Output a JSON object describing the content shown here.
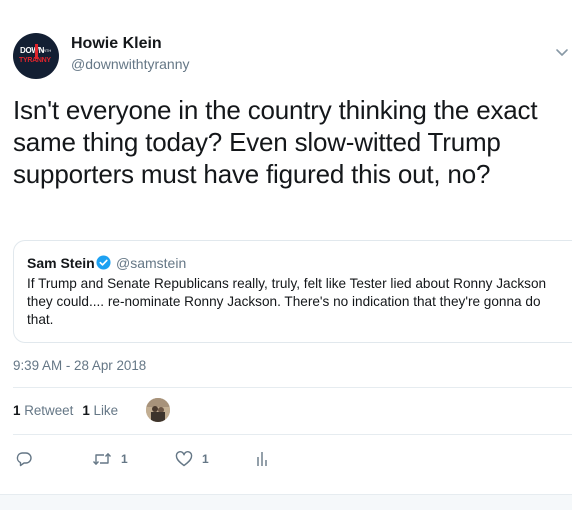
{
  "author": {
    "display_name": "Howie Klein",
    "handle": "@downwithtyranny",
    "avatar_text_top": "DOWN",
    "avatar_text_small": "WITH",
    "avatar_text_bottom": "TYRANNY"
  },
  "tweet": {
    "text": "Isn't everyone in the country thinking the exact same thing today? Even slow-witted Trump supporters must have figured this out, no?",
    "timestamp": "9:39 AM - 28 Apr 2018"
  },
  "quoted_tweet": {
    "display_name": "Sam Stein",
    "handle": "@samstein",
    "text": "If Trump and Senate Republicans really, truly, felt like Tester lied about Ronny Jackson they could.... re-nominate Ronny Jackson. There's no indication that they're gonna do that."
  },
  "stats": {
    "retweets_count": "1",
    "retweets_label": "Retweet",
    "likes_count": "1",
    "likes_label": "Like"
  },
  "actions": {
    "reply_icon": "reply-icon",
    "retweet_icon": "retweet-icon",
    "retweet_count": "1",
    "like_icon": "heart-icon",
    "like_count": "1",
    "analytics_icon": "analytics-icon"
  },
  "colors": {
    "text": "#14171a",
    "secondary": "#657786",
    "verified": "#1da1f2",
    "border": "#e1e8ed"
  }
}
